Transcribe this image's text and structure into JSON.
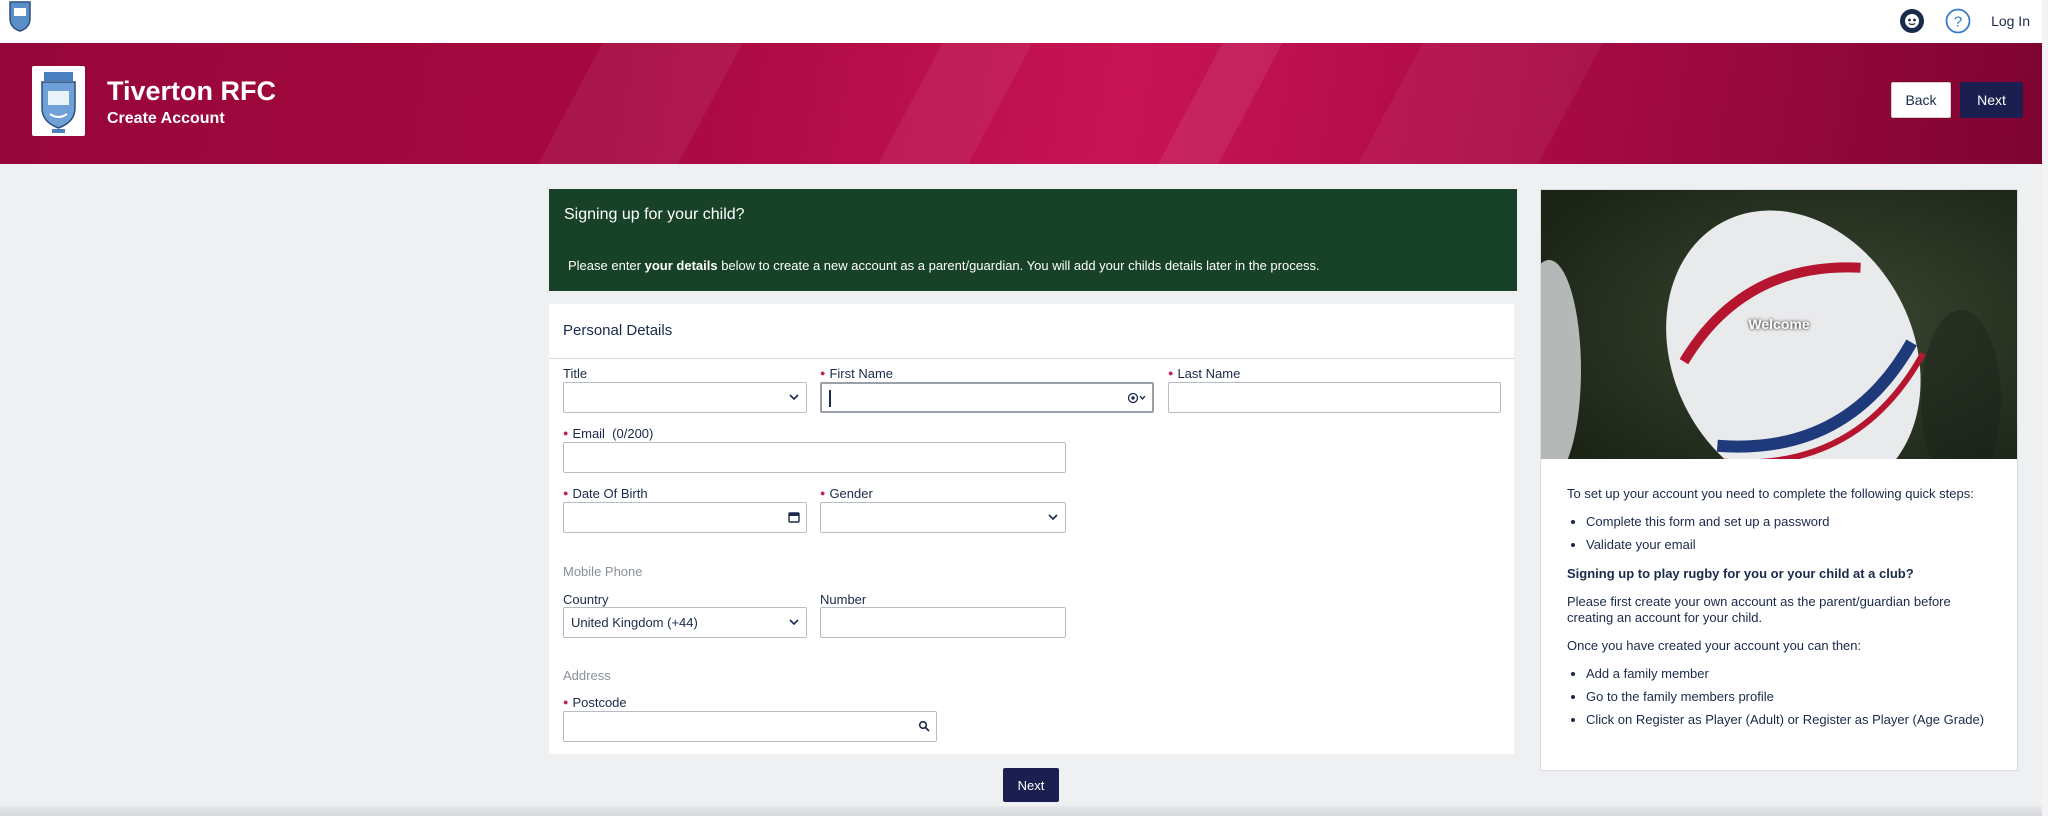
{
  "topbar": {
    "login_label": "Log In"
  },
  "banner": {
    "club_name": "Tiverton RFC",
    "sub_title": "Create Account",
    "back_label": "Back",
    "next_label": "Next"
  },
  "info": {
    "heading": "Signing up for your child?",
    "message_prefix": "Please enter ",
    "message_bold": "your details",
    "message_suffix": " below to create a new account as a parent/guardian. You will add your childs details later in the process."
  },
  "form": {
    "section_title": "Personal Details",
    "title_label": "Title",
    "title_value": "",
    "first_name_label": "First Name",
    "first_name_value": "",
    "last_name_label": "Last Name",
    "last_name_value": "",
    "email_label": "Email  (0/200)",
    "email_value": "",
    "dob_label": "Date Of Birth",
    "dob_value": "",
    "gender_label": "Gender",
    "gender_value": "",
    "mobile_group": "Mobile Phone",
    "country_label": "Country",
    "country_value": "United Kingdom (+44)",
    "number_label": "Number",
    "number_value": "",
    "address_group": "Address",
    "postcode_label": "Postcode",
    "postcode_value": "",
    "next_label": "Next"
  },
  "side": {
    "welcome": "Welcome",
    "intro": "To set up your account you need to complete the following quick steps:",
    "steps": [
      "Complete this form and set up a password",
      "Validate your email"
    ],
    "bold_heading": "Signing up to play rugby for you or your child at a club?",
    "para1": "Please first create your own account as the parent/guardian before creating an account for your child.",
    "para2": "Once you have created your account you can then:",
    "actions": [
      "Add a family member",
      "Go to the family members profile",
      "Click on Register as Player (Adult) or Register as Player (Age Grade)"
    ]
  },
  "colors": {
    "banner": "#a5083f",
    "info_box": "#174228",
    "primary_button": "#1b1f4f",
    "required_marker": "#c41f5a"
  }
}
